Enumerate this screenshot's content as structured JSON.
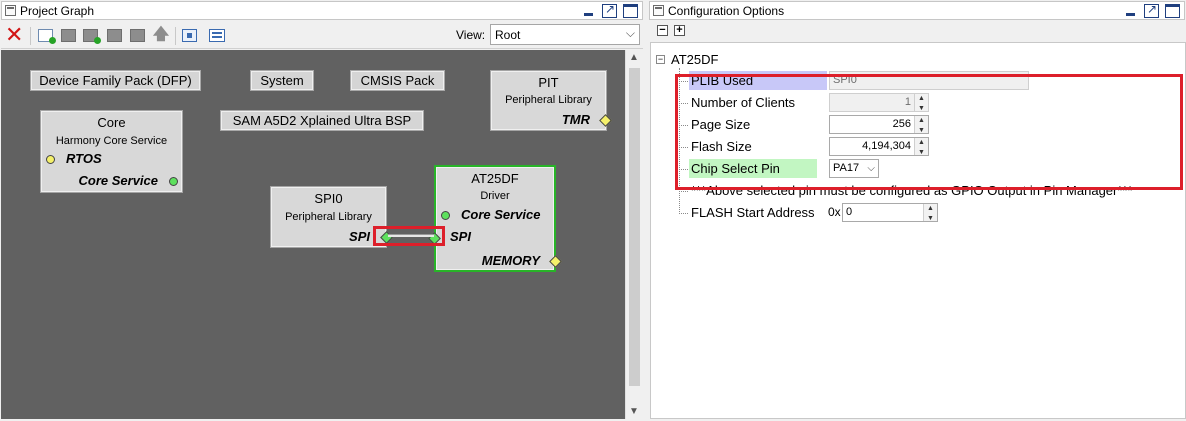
{
  "left_panel": {
    "title": "Project Graph",
    "toolbar": {
      "view_label": "View:",
      "view_value": "Root"
    },
    "pills": {
      "dfp": "Device Family Pack (DFP)",
      "system": "System",
      "cmsis": "CMSIS Pack",
      "bsp": "SAM A5D2 Xplained Ultra BSP"
    },
    "components": {
      "pit": {
        "title": "PIT",
        "subtitle": "Peripheral Library",
        "port_tmr": "TMR"
      },
      "core": {
        "title": "Core",
        "subtitle": "Harmony Core Service",
        "port_rtos": "RTOS",
        "port_core": "Core Service"
      },
      "spi0": {
        "title": "SPI0",
        "subtitle": "Peripheral Library",
        "port_spi": "SPI"
      },
      "at25df": {
        "title": "AT25DF",
        "subtitle": "Driver",
        "port_core": "Core Service",
        "port_spi": "SPI",
        "port_memory": "MEMORY"
      }
    }
  },
  "right_panel": {
    "title": "Configuration Options",
    "tree": {
      "root_label": "AT25DF",
      "plib_used_label": "PLIB Used",
      "plib_used_value": "SPI0",
      "clients_label": "Number of Clients",
      "clients_value": "1",
      "page_size_label": "Page Size",
      "page_size_value": "256",
      "flash_size_label": "Flash Size",
      "flash_size_value": "4,194,304",
      "cs_pin_label": "Chip Select Pin",
      "cs_pin_value": "PA17",
      "note": "***Above selected pin must be configured as GPIO Output in Pin Manager***",
      "flash_start_label": "FLASH Start Address",
      "flash_start_prefix": "0x",
      "flash_start_value": "0"
    }
  },
  "colors": {
    "canvas": "#616161",
    "highlight": "#dd1f2a",
    "selected_border": "#28b428",
    "plib_label_bg": "#c8c8f8",
    "cs_label_bg": "#c2f6c2"
  }
}
